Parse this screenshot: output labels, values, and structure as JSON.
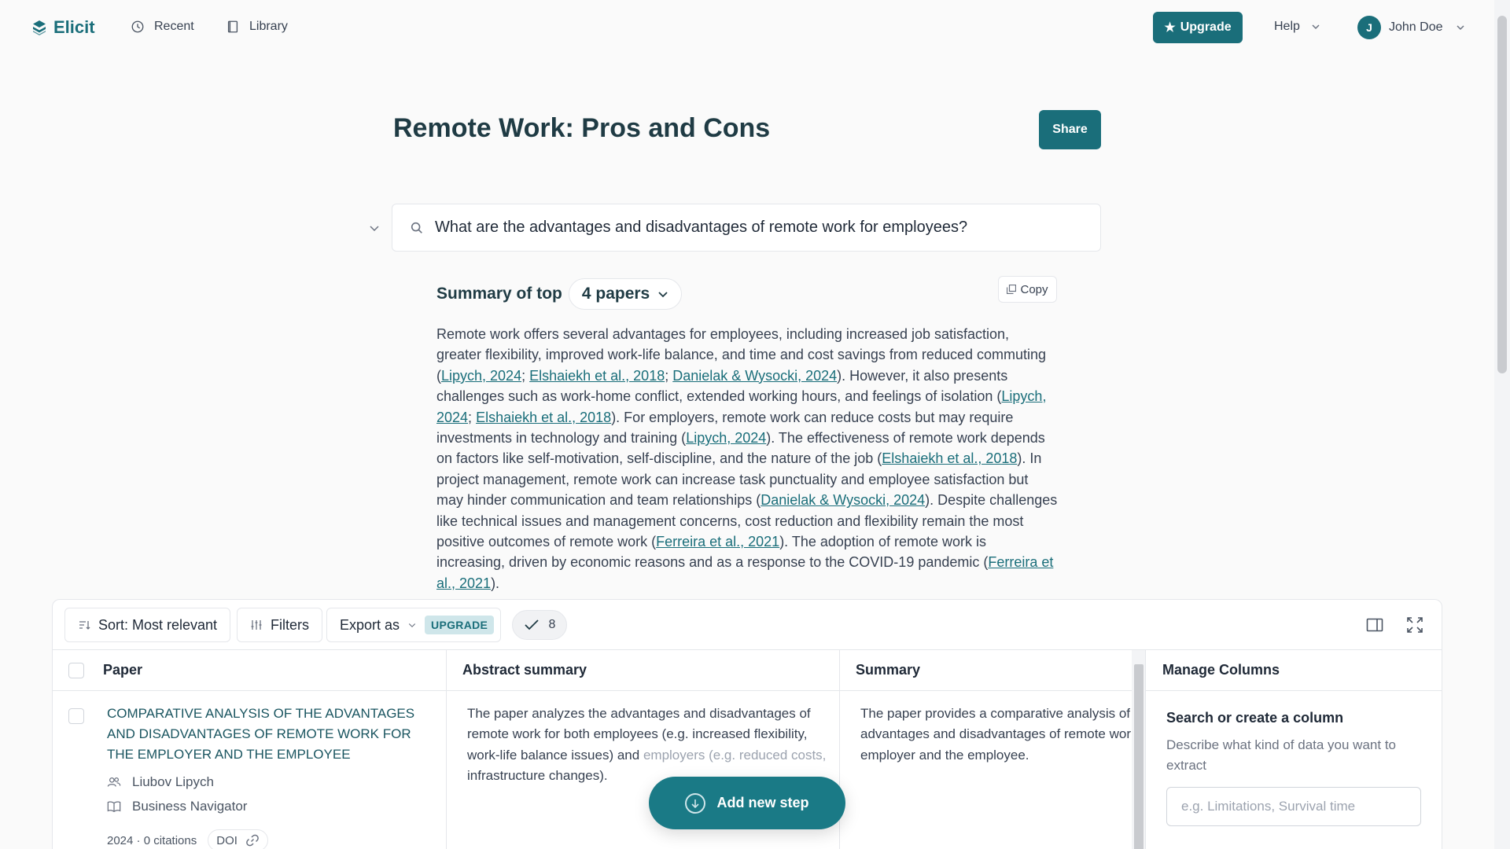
{
  "nav": {
    "logo": "Elicit",
    "recent": "Recent",
    "library": "Library",
    "upgrade": "Upgrade",
    "help": "Help",
    "user_initial": "J",
    "user_name": "John Doe"
  },
  "page": {
    "title": "Remote Work: Pros and Cons",
    "share": "Share"
  },
  "query": "What are the advantages and disadvantages of remote work for employees?",
  "summary": {
    "label": "Summary of top",
    "papers": "4 papers",
    "copy": "Copy",
    "segments": [
      {
        "t": "Remote work offers several advantages for employees, including increased job satisfaction, greater flexibility, improved work-life balance, and time and cost savings from reduced commuting ("
      },
      {
        "link": "Lipych, 2024"
      },
      {
        "t": "; "
      },
      {
        "link": "Elshaiekh et al., 2018"
      },
      {
        "t": "; "
      },
      {
        "link": "Danielak & Wysocki, 2024"
      },
      {
        "t": "). However, it also presents challenges such as work-home conflict, extended working hours, and feelings of isolation ("
      },
      {
        "link": "Lipych, 2024"
      },
      {
        "t": "; "
      },
      {
        "link": "Elshaiekh et al., 2018"
      },
      {
        "t": "). For employers, remote work can reduce costs but may require investments in technology and training ("
      },
      {
        "link": "Lipych, 2024"
      },
      {
        "t": "). The effectiveness of remote work depends on factors like self-motivation, self-discipline, and the nature of the job ("
      },
      {
        "link": "Elshaiekh et al., 2018"
      },
      {
        "t": "). In project management, remote work can increase task punctuality and employee satisfaction but may hinder communication and team relationships ("
      },
      {
        "link": "Danielak & Wysocki, 2024"
      },
      {
        "t": "). Despite challenges like technical issues and management concerns, cost reduction and flexibility remain the most positive outcomes of remote work ("
      },
      {
        "link": "Ferreira et al., 2021"
      },
      {
        "t": "). The adoption of remote work is increasing, driven by economic reasons and as a response to the COVID-19 pandemic ("
      },
      {
        "link": "Ferreira et al., 2021"
      },
      {
        "t": ")."
      }
    ]
  },
  "toolbar": {
    "sort": "Sort: Most relevant",
    "filters": "Filters",
    "export": "Export as",
    "upgrade_badge": "UPGRADE",
    "checked_count": "8"
  },
  "table": {
    "columns": [
      "Paper",
      "Abstract summary",
      "Summary"
    ],
    "row": {
      "title": "COMPARATIVE ANALYSIS OF THE ADVANTAGES AND DISADVANTAGES OF REMOTE WORK FOR THE EMPLOYER AND THE EMPLOYEE",
      "author": "Liubov Lipych",
      "journal": "Business Navigator",
      "year_citations": "2024 · 0 citations",
      "doi": "DOI",
      "abstract_summary": "The paper analyzes the advantages and disadvantages of remote work for both employees (e.g. increased flexibility, work-life balance issues) and",
      "abstract_summary_faded": "employers (e.g. reduced costs,",
      "abstract_summary_end": "infrastructure changes).",
      "summary": "The paper provides a comparative analysis of the advantages and disadvantages of remote work for the employer and the employee."
    }
  },
  "manage": {
    "title": "Manage Columns",
    "subtitle": "Search or create a column",
    "description": "Describe what kind of data you want to extract",
    "placeholder": "e.g. Limitations, Survival time"
  },
  "add_step": "Add new step",
  "colors": {
    "accent": "#1a6e7a",
    "badge_bg": "#cfe6ea"
  }
}
